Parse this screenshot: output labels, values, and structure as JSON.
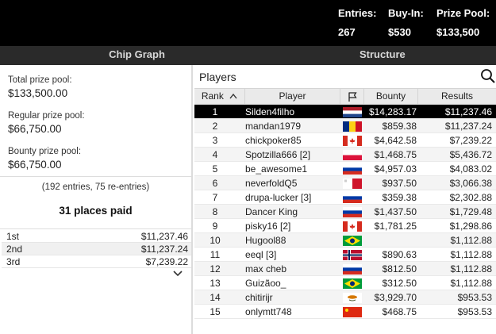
{
  "header": {
    "stats": [
      {
        "label": "Entries:",
        "value": "267"
      },
      {
        "label": "Buy-In:",
        "value": "$530"
      },
      {
        "label": "Prize Pool:",
        "value": "$133,500"
      }
    ]
  },
  "tabs": [
    {
      "label": "Chip Graph"
    },
    {
      "label": "Structure"
    }
  ],
  "left": {
    "pools": [
      {
        "label": "Total prize pool:",
        "value": "$133,500.00"
      },
      {
        "label": "Regular prize pool:",
        "value": "$66,750.00"
      },
      {
        "label": "Bounty prize pool:",
        "value": "$66,750.00"
      }
    ],
    "entries_note": "(192 entries, 75 re-entries)",
    "places_paid": "31 places paid",
    "payouts": [
      {
        "place": "1st",
        "amount": "$11,237.46"
      },
      {
        "place": "2nd",
        "amount": "$11,237.24"
      },
      {
        "place": "3rd",
        "amount": "$7,239.22"
      }
    ],
    "expand_icon": "chevron-down-icon"
  },
  "players": {
    "title": "Players",
    "search_icon": "search-icon",
    "columns": {
      "rank": "Rank",
      "player": "Player",
      "flag_icon": "flag-icon",
      "bounty": "Bounty",
      "results": "Results"
    },
    "sort_icon": "sort-ascending-icon",
    "rows": [
      {
        "rank": "1",
        "player": "Silden4filho",
        "country": "netherlands",
        "bounty": "$14,283.17",
        "results": "$11,237.46",
        "selected": true
      },
      {
        "rank": "2",
        "player": "mandan1979",
        "country": "romania",
        "bounty": "$859.38",
        "results": "$11,237.24"
      },
      {
        "rank": "3",
        "player": "chickpoker85",
        "country": "canada",
        "bounty": "$4,642.58",
        "results": "$7,239.22"
      },
      {
        "rank": "4",
        "player": "Spotzilla666 [2]",
        "country": "poland",
        "bounty": "$1,468.75",
        "results": "$5,436.72"
      },
      {
        "rank": "5",
        "player": "be_awesome1",
        "country": "russia",
        "bounty": "$4,957.03",
        "results": "$4,083.02"
      },
      {
        "rank": "6",
        "player": "neverfoldQ5",
        "country": "malta",
        "bounty": "$937.50",
        "results": "$3,066.38"
      },
      {
        "rank": "7",
        "player": "drupa-lucker [3]",
        "country": "russia",
        "bounty": "$359.38",
        "results": "$2,302.88"
      },
      {
        "rank": "8",
        "player": "Dancer King",
        "country": "russia",
        "bounty": "$1,437.50",
        "results": "$1,729.48"
      },
      {
        "rank": "9",
        "player": "pisky16 [2]",
        "country": "canada",
        "bounty": "$1,781.25",
        "results": "$1,298.86"
      },
      {
        "rank": "10",
        "player": "Hugool88",
        "country": "brazil",
        "bounty": "",
        "results": "$1,112.88"
      },
      {
        "rank": "11",
        "player": "eeql [3]",
        "country": "norway",
        "bounty": "$890.63",
        "results": "$1,112.88"
      },
      {
        "rank": "12",
        "player": "max cheb",
        "country": "russia",
        "bounty": "$812.50",
        "results": "$1,112.88"
      },
      {
        "rank": "13",
        "player": "Guizãoo_",
        "country": "brazil",
        "bounty": "$312.50",
        "results": "$1,112.88"
      },
      {
        "rank": "14",
        "player": "chitirijr",
        "country": "cyprus",
        "bounty": "$3,929.70",
        "results": "$953.53"
      },
      {
        "rank": "15",
        "player": "onlymtt748",
        "country": "china",
        "bounty": "$468.75",
        "results": "$953.53"
      }
    ]
  }
}
